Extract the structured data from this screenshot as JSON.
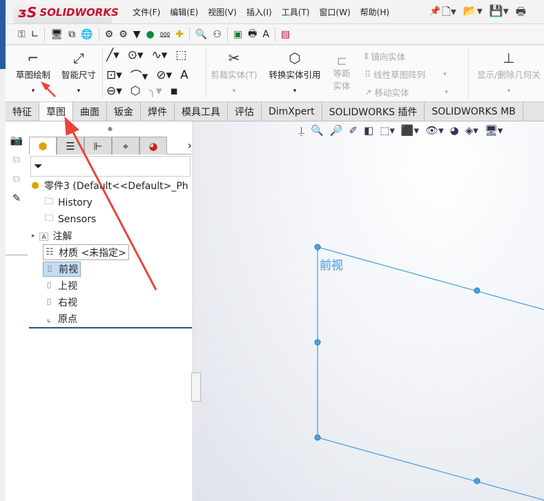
{
  "app": {
    "logo": "SOLIDWORKS"
  },
  "menu": [
    "文件(F)",
    "编辑(E)",
    "视图(V)",
    "插入(I)",
    "工具(T)",
    "窗口(W)",
    "帮助(H)"
  ],
  "quick_icons": [
    "pin-icon",
    "new-document-icon",
    "open-icon",
    "save-icon",
    "print-icon"
  ],
  "toolbar2_icons": [
    "key-icon",
    "angle-icon",
    "monitor-icon",
    "network-icon",
    "globe-icon",
    "gear-icon",
    "gear-dark-icon",
    "bucket-icon",
    "location-icon",
    "wave-icon",
    "plus-icon",
    "search-icon",
    "binoculars-icon",
    "excel-icon",
    "printer-icon",
    "text-image-icon",
    "help-book-icon"
  ],
  "command_manager": {
    "sketch": "草图绘制",
    "smart_dim": "智能尺寸",
    "trim": "剪裁实体(T)",
    "convert": "转换实体引用",
    "offset": "等距实体",
    "mirror": "镜向实体",
    "linear_pattern": "线性草图阵列",
    "move": "移动实体",
    "show_delete": "显示/删除几何关"
  },
  "tabs": [
    "特征",
    "草图",
    "曲面",
    "钣金",
    "焊件",
    "模具工具",
    "评估",
    "DimXpert",
    "SOLIDWORKS 插件",
    "SOLIDWORKS MB"
  ],
  "active_tab": "草图",
  "tree": {
    "root": "零件3  (Default<<Default>_Ph",
    "items": [
      "History",
      "Sensors",
      "注解",
      "材质 <未指定>",
      "前视",
      "上视",
      "右视",
      "原点"
    ],
    "selected": "前视"
  },
  "viewport": {
    "plane_label": "前视",
    "plane_color": "#4aa3e0"
  },
  "annotation_color": "#e8453c"
}
